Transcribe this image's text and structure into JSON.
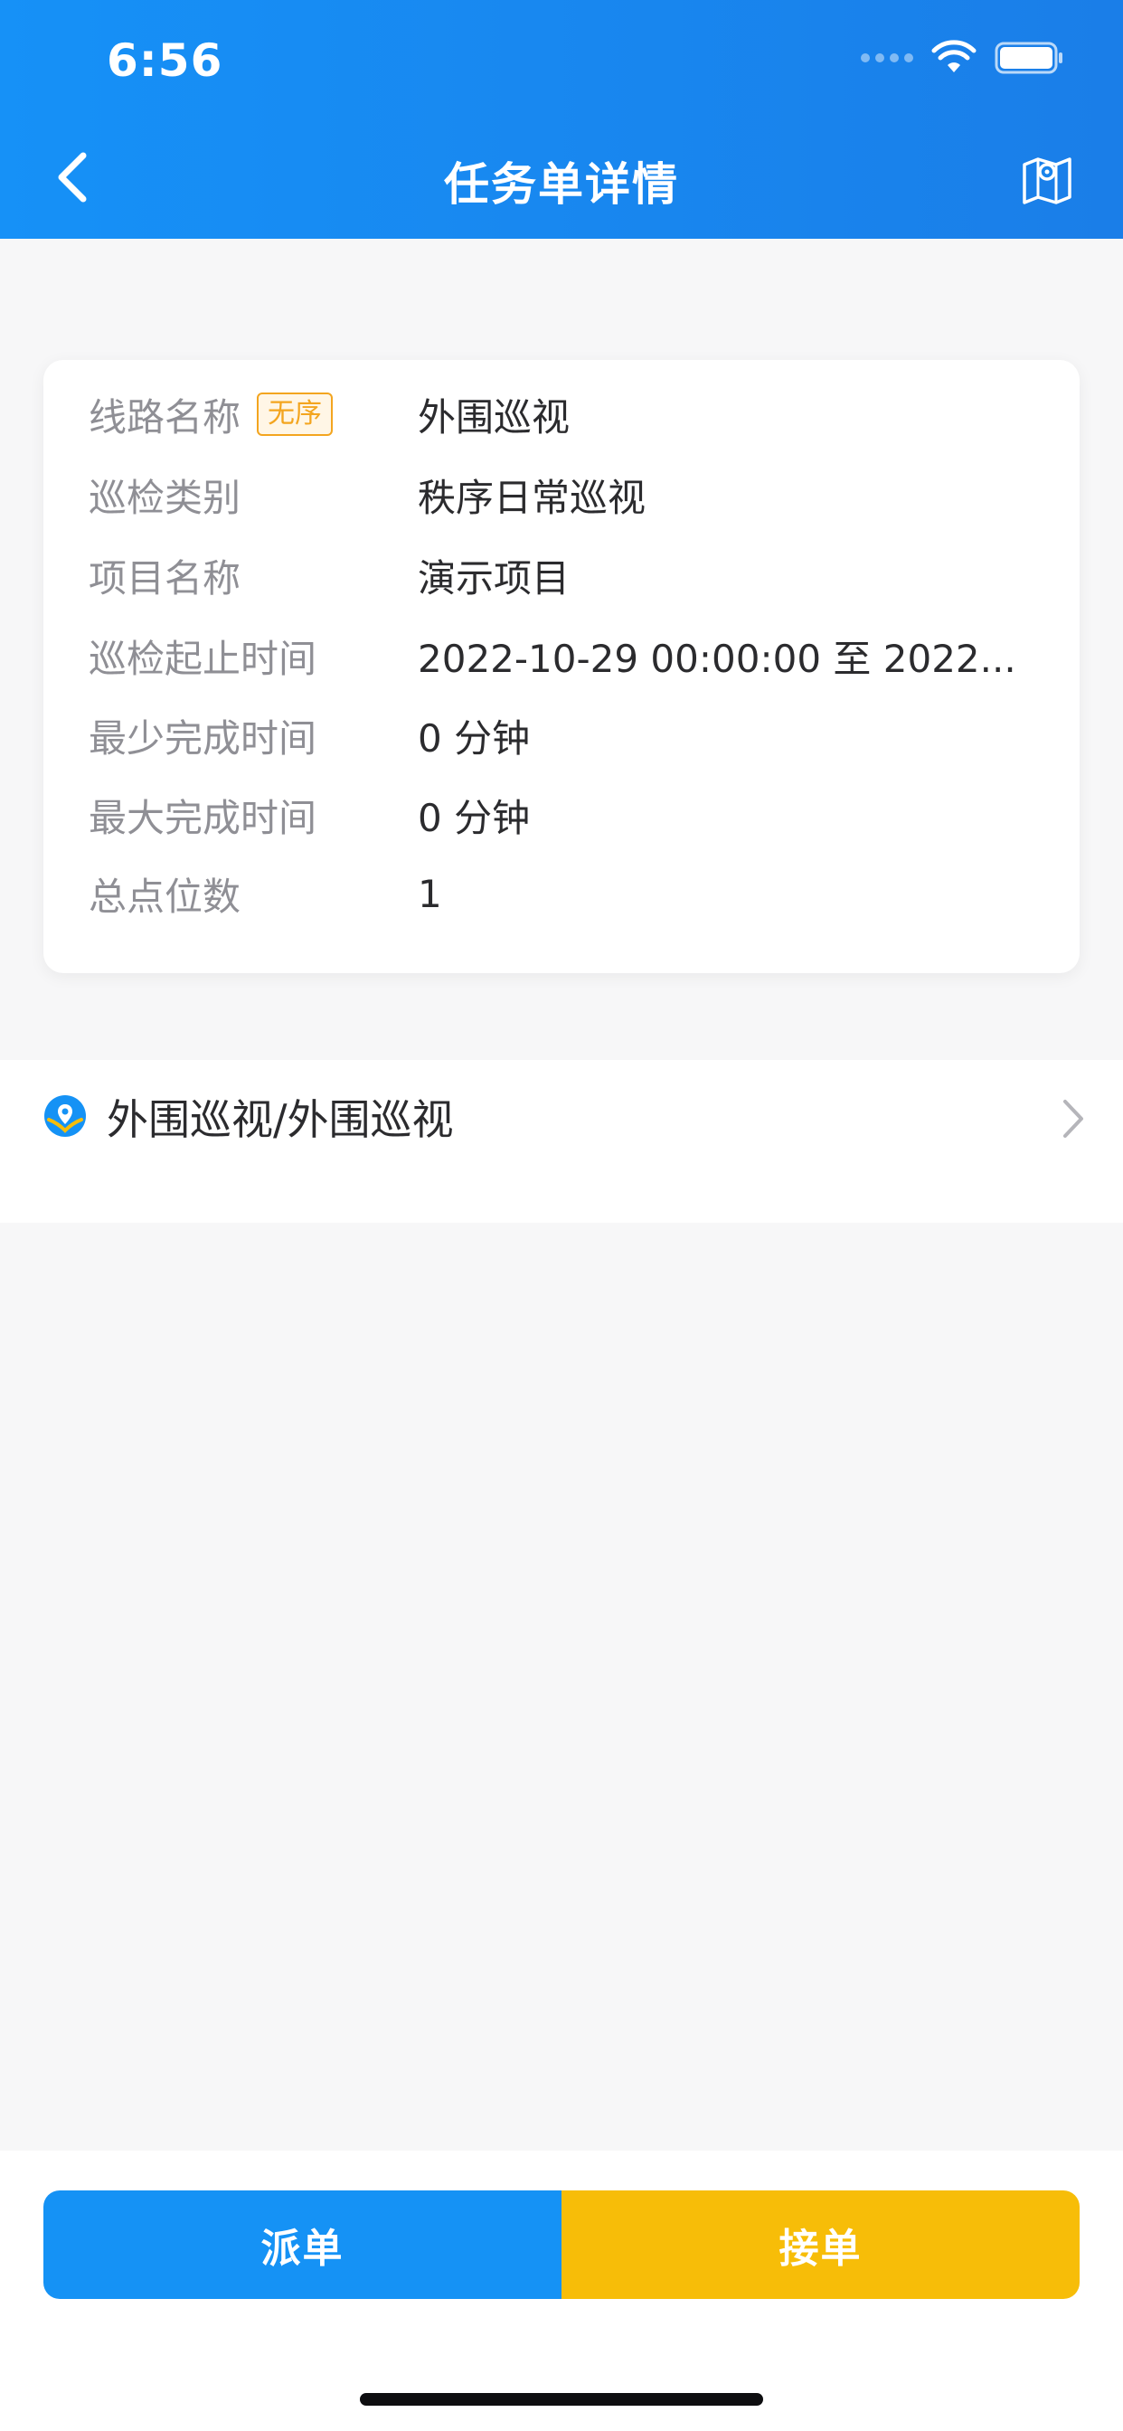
{
  "status_bar": {
    "time": "6:56"
  },
  "header": {
    "title": "任务单详情"
  },
  "info": {
    "tag": "无序",
    "rows": [
      {
        "label": "线路名称",
        "value": "外围巡视"
      },
      {
        "label": "巡检类别",
        "value": "秩序日常巡视"
      },
      {
        "label": "项目名称",
        "value": "演示项目"
      },
      {
        "label": "巡检起止时间",
        "value": "2022-10-29 00:00:00 至 2022..."
      },
      {
        "label": "最少完成时间",
        "value": "0 分钟"
      },
      {
        "label": "最大完成时间",
        "value": "0 分钟"
      },
      {
        "label": "总点位数",
        "value": "1"
      }
    ]
  },
  "route": {
    "label": "外围巡视/外围巡视",
    "icon": "location-pin-icon"
  },
  "actions": {
    "dispatch": "派单",
    "accept": "接单"
  },
  "colors": {
    "primary": "#1592f5",
    "accent": "#f7bd08",
    "tag": "#f3a51f"
  }
}
